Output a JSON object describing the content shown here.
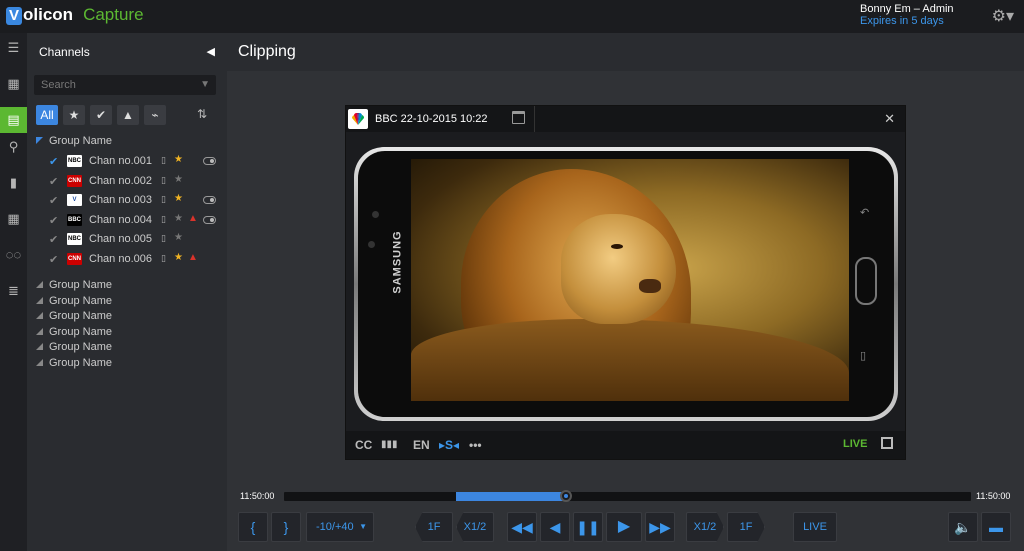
{
  "app": {
    "brand_v": "V",
    "brand_rest": "olicon",
    "product": "Capture",
    "user_name": "Bonny Em – Admin",
    "user_expiry": "Expires in 5 days"
  },
  "sidebar": {
    "title": "Channels",
    "search_placeholder": "Search",
    "filter_all": "All",
    "open_group": "Group Name",
    "channels": [
      {
        "name": "Chan no.001",
        "logo": "NBC",
        "checked": true,
        "star": "gold",
        "warn": false,
        "toggle": true
      },
      {
        "name": "Chan no.002",
        "logo": "CNN",
        "checked": false,
        "star": "grey",
        "warn": false,
        "toggle": false
      },
      {
        "name": "Chan no.003",
        "logo": "V",
        "checked": false,
        "star": "gold",
        "warn": false,
        "toggle": true
      },
      {
        "name": "Chan no.004",
        "logo": "BBC",
        "checked": false,
        "star": "grey",
        "warn": true,
        "toggle": true
      },
      {
        "name": "Chan no.005",
        "logo": "NBC",
        "checked": false,
        "star": "grey",
        "warn": false,
        "toggle": false
      },
      {
        "name": "Chan no.006",
        "logo": "CNN",
        "checked": false,
        "star": "gold",
        "warn": true,
        "toggle": false
      }
    ],
    "closed_groups": [
      "Group Name",
      "Group Name",
      "Group Name",
      "Group Name",
      "Group Name",
      "Group Name"
    ]
  },
  "main": {
    "title": "Clipping"
  },
  "player": {
    "channel_title": "BBC  22-10-2015 10:22",
    "phone_brand": "SAMSUNG",
    "footer": {
      "cc": "CC",
      "lang": "EN",
      "subs": "S",
      "more": "•••",
      "live": "LIVE"
    }
  },
  "timeline": {
    "start": "11:50:00",
    "end": "11:50:00",
    "selection_start_fraction": 0.25,
    "selection_end_fraction": 0.41
  },
  "controls": {
    "mark_in": "{",
    "mark_out": "}",
    "offset": "-10/+40",
    "step_back_frame": "1F",
    "slow_back": "X1/2",
    "slow_forward": "X1/2",
    "step_forward_frame": "1F",
    "live": "LIVE"
  },
  "colors": {
    "accent_blue": "#3c86e0",
    "accent_green": "#5cb832",
    "warn_red": "#d9332b",
    "star_gold": "#f0b323"
  }
}
